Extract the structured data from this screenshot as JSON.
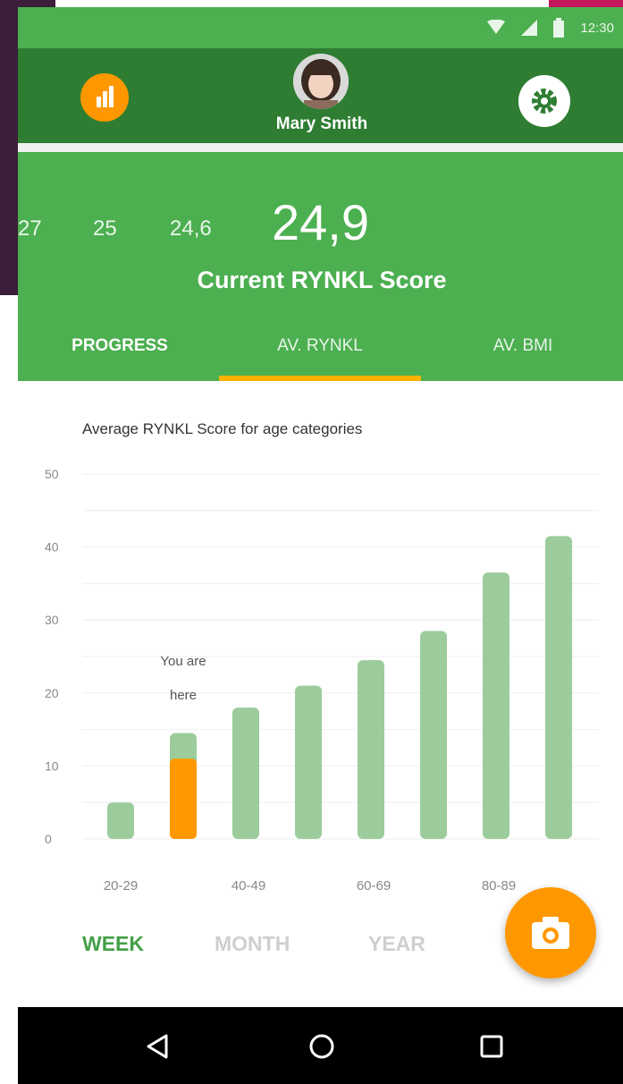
{
  "status_bar": {
    "time": "12:30",
    "icons": [
      "wifi-icon",
      "signal-icon",
      "battery-icon"
    ]
  },
  "header": {
    "user_name": "Mary Smith",
    "left_icon": "bar-chart-icon",
    "right_icon": "gear-icon",
    "accent_color": "#ff9800"
  },
  "score": {
    "history": [
      "27",
      "25",
      "24,6"
    ],
    "current": "24,9",
    "label": "Current RYNKL Score"
  },
  "tabs": [
    {
      "label": "PROGRESS"
    },
    {
      "label": "AV. RYNKL",
      "selected": true
    },
    {
      "label": "AV. BMI"
    }
  ],
  "chart_title": "Average RYNKL Score for age categories",
  "chart_data": {
    "type": "bar",
    "title": "Average RYNKL Score for age categories",
    "y_ticks": [
      "0",
      "10",
      "20",
      "30",
      "40",
      "50"
    ],
    "ylim": [
      0,
      50
    ],
    "x_tick_labels": [
      "20-29",
      "40-49",
      "60-69",
      "80-89"
    ],
    "values": [
      5,
      14.5,
      18,
      21,
      24.5,
      28.5,
      36.5,
      41.5
    ],
    "highlight": {
      "index": 1,
      "value": 11,
      "color": "#ff9800"
    },
    "bar_color": "#9ccc9c",
    "annotation": [
      "You are",
      "here"
    ],
    "grid": true
  },
  "range_tabs": [
    {
      "label": "WEEK",
      "active": true
    },
    {
      "label": "MONTH"
    },
    {
      "label": "YEAR"
    }
  ],
  "fab_icon": "camera-icon",
  "nav": {
    "icons": [
      "back-icon",
      "home-icon",
      "recents-icon"
    ]
  }
}
